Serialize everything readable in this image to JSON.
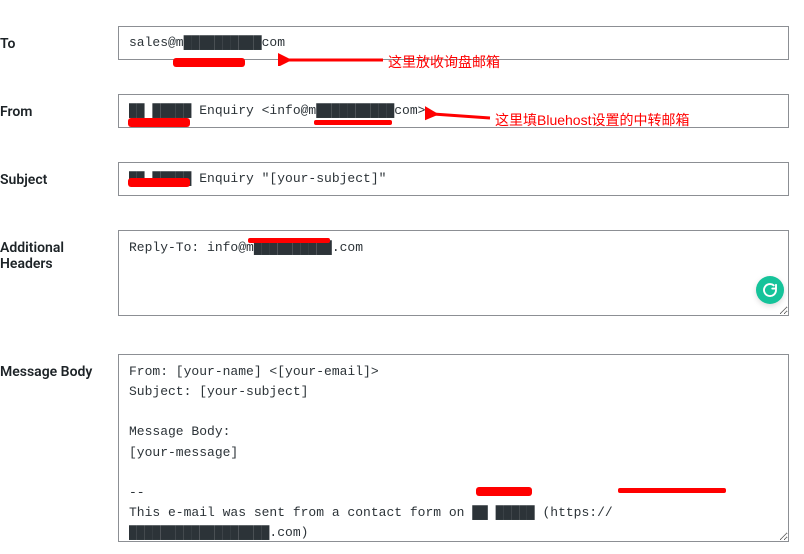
{
  "labels": {
    "to": "To",
    "from": "From",
    "subject": "Subject",
    "additional_headers": "Additional\nHeaders",
    "message_body": "Message Body"
  },
  "fields": {
    "to": "sales@m██████████com",
    "from": "██ █████ Enquiry <info@m██████████com>",
    "subject": "██ █████ Enquiry \"[your-subject]\"",
    "additional_headers": "Reply-To: info@m██████████.com",
    "message_body": "From: [your-name] <[your-email]>\nSubject: [your-subject]\n\nMessage Body:\n[your-message]\n\n--\nThis e-mail was sent from a contact form on ██ █████ (https://██████████████████.com)"
  },
  "annotations": {
    "to_note": "这里放收询盘邮箱",
    "from_note": "这里填Bluehost设置的中转邮箱"
  },
  "icons": {
    "grammarly": "grammarly-badge"
  }
}
